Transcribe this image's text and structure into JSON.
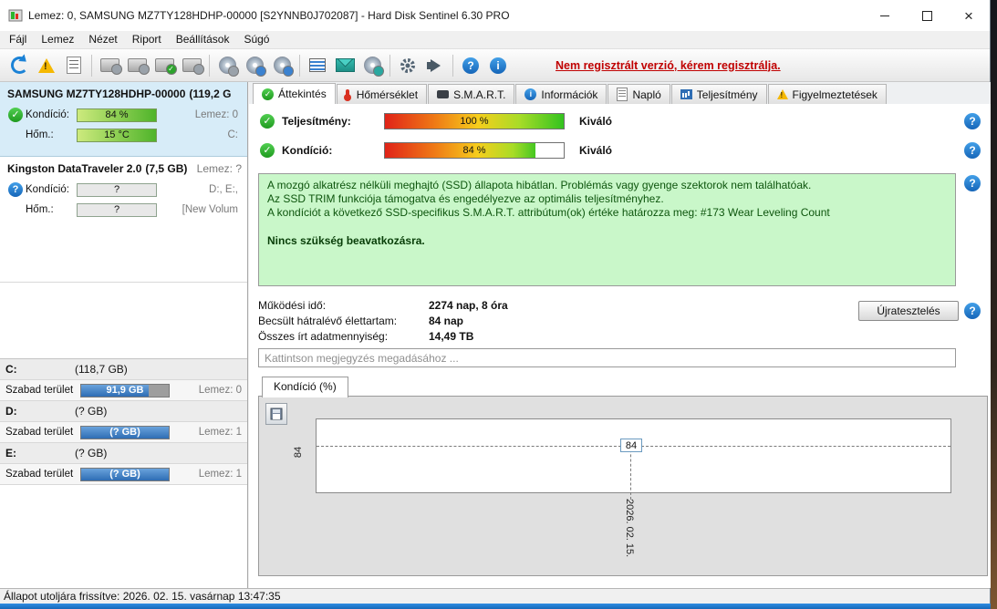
{
  "window": {
    "title": "Lemez: 0, SAMSUNG MZ7TY128HDHP-00000 [S2YNNB0J702087]  -  Hard Disk Sentinel 6.30 PRO"
  },
  "menu": {
    "items": [
      "Fájl",
      "Lemez",
      "Nézet",
      "Riport",
      "Beállítások",
      "Súgó"
    ]
  },
  "toolbar": {
    "register_link": "Nem regisztrált verzió, kérem regisztrálja.",
    "icons": [
      "refresh",
      "warning-status",
      "report",
      "disk-undo",
      "disk-remove",
      "disk-accept",
      "disk-test",
      "removable-eject",
      "disk-settings",
      "disk-tools",
      "panel",
      "email-alert",
      "sound-alert",
      "settings-gear",
      "acoustic",
      "help",
      "information"
    ]
  },
  "sidebar": {
    "disks": [
      {
        "name": "SAMSUNG MZ7TY128HDHP-00000",
        "size": "(119,2 G",
        "condition_label": "Kondíció:",
        "condition_value": "84 %",
        "disk_no": "Lemez: 0",
        "temp_label": "Hőm.:",
        "temp_value": "15 °C",
        "drives": "C:"
      },
      {
        "name": "Kingston DataTraveler 2.0",
        "size": "(7,5 GB)",
        "disk_no": "Lemez: ?",
        "condition_label": "Kondíció:",
        "condition_value": "?",
        "drives": "D:, E:,",
        "temp_label": "Hőm.:",
        "temp_value": "?",
        "volume": "[New Volum"
      }
    ],
    "partitions": [
      {
        "letter": "C:",
        "size": "(118,7 GB)",
        "free_label": "Szabad terület",
        "free_value": "91,9 GB",
        "disk_no": "Lemez: 0",
        "fill_percent": 77
      },
      {
        "letter": "D:",
        "size": "(? GB)",
        "free_label": "Szabad terület",
        "free_value": "(? GB)",
        "disk_no": "Lemez: 1",
        "fill_percent": 100
      },
      {
        "letter": "E:",
        "size": "(? GB)",
        "free_label": "Szabad terület",
        "free_value": "(? GB)",
        "disk_no": "Lemez: 1",
        "fill_percent": 100
      }
    ]
  },
  "tabs": [
    {
      "label": "Áttekintés",
      "icon": "check-circle",
      "active": true
    },
    {
      "label": "Hőmérséklet",
      "icon": "thermometer",
      "active": false
    },
    {
      "label": "S.M.A.R.T.",
      "icon": "smart-drive",
      "active": false
    },
    {
      "label": "Információk",
      "icon": "info-circle",
      "active": false
    },
    {
      "label": "Napló",
      "icon": "document",
      "active": false
    },
    {
      "label": "Teljesítmény",
      "icon": "performance-chart",
      "active": false
    },
    {
      "label": "Figyelmeztetések",
      "icon": "warning-page",
      "active": false
    }
  ],
  "overview": {
    "performance": {
      "label": "Teljesítmény:",
      "value": "100 %",
      "percent": 100,
      "rating": "Kiváló"
    },
    "condition": {
      "label": "Kondíció:",
      "value": "84 %",
      "percent": 84,
      "rating": "Kiváló"
    },
    "health_text": {
      "line1": "A mozgó alkatrész nélküli meghajtó (SSD) állapota hibátlan. Problémás vagy gyenge szektorok nem találhatóak.",
      "line2": "Az SSD TRIM funkciója támogatva és engedélyezve az optimális teljesítményhez.",
      "line3": "A kondíciót a következő SSD-specifikus S.M.A.R.T. attribútum(ok) értéke határozza meg:  #173 Wear Leveling Count",
      "line4": "Nincs szükség beavatkozásra."
    },
    "stats": [
      {
        "label": "Működési idő:",
        "value": "2274 nap, 8 óra"
      },
      {
        "label": "Becsült hátralévő élettartam:",
        "value": "84 nap"
      },
      {
        "label": "Összes írt adatmennyiség:",
        "value": "14,49 TB"
      }
    ],
    "retest_button": "Újratesztelés",
    "comment_placeholder": "Kattintson megjegyzés megadásához ..."
  },
  "chart_tab": {
    "label": "Kondíció  (%)"
  },
  "chart_data": {
    "type": "line",
    "title": "Kondíció (%)",
    "x": [
      "2026. 02. 15."
    ],
    "series": [
      {
        "name": "Kondíció",
        "values": [
          84
        ]
      }
    ],
    "ylim": [
      0,
      100
    ],
    "y_ticks": [
      "84"
    ],
    "point_label": "84",
    "grid": "dashed-crosshair",
    "legend": "none"
  },
  "statusbar": {
    "text": "Állapot utoljára frissítve: 2026. 02. 15. vasárnap 13:47:35"
  }
}
